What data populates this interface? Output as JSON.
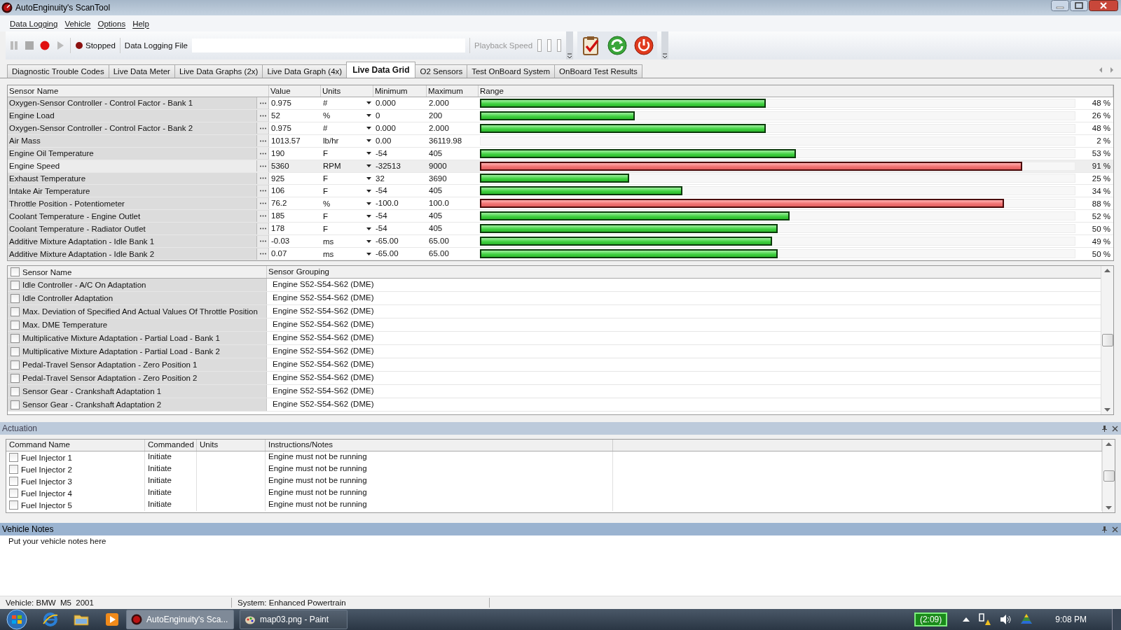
{
  "window": {
    "title": "AutoEnginuity's ScanTool"
  },
  "menu": [
    "Data Logging",
    "Vehicle",
    "Options",
    "Help"
  ],
  "toolbar": {
    "status": "Stopped",
    "logging_file_label": "Data Logging File",
    "playback_label": "Playback Speed"
  },
  "tabs": [
    {
      "label": "Diagnostic Trouble Codes",
      "selected": false
    },
    {
      "label": "Live Data Meter",
      "selected": false
    },
    {
      "label": "Live Data Graphs (2x)",
      "selected": false
    },
    {
      "label": "Live Data Graph (4x)",
      "selected": false
    },
    {
      "label": "Live Data Grid",
      "selected": true
    },
    {
      "label": "O2 Sensors",
      "selected": false
    },
    {
      "label": "Test OnBoard System",
      "selected": false
    },
    {
      "label": "OnBoard Test Results",
      "selected": false
    }
  ],
  "live_grid": {
    "columns": [
      "Sensor Name",
      "Value",
      "Units",
      "Minimum",
      "Maximum",
      "Range"
    ],
    "rows": [
      {
        "name": "Oxygen-Sensor Controller - Control Factor - Bank 1",
        "value": "0.975",
        "unit": "#",
        "minimum": "0.000",
        "maximum": "2.000",
        "level": 0.48,
        "reading": "48 %",
        "alarm": false,
        "selected": false
      },
      {
        "name": "Engine Load",
        "value": "52",
        "unit": "%",
        "minimum": "0",
        "maximum": "200",
        "level": 0.26,
        "reading": "26 %",
        "alarm": false,
        "selected": false
      },
      {
        "name": "Oxygen-Sensor Controller - Control Factor - Bank 2",
        "value": "0.975",
        "unit": "#",
        "minimum": "0.000",
        "maximum": "2.000",
        "level": 0.48,
        "reading": "48 %",
        "alarm": false,
        "selected": false
      },
      {
        "name": "Air Mass",
        "value": "1013.57",
        "unit": "lb/hr",
        "minimum": "0.00",
        "maximum": "36119.98",
        "reading": "2 %",
        "selected": false
      },
      {
        "name": "Engine Oil Temperature",
        "value": "190",
        "unit": "F",
        "minimum": "-54",
        "maximum": "405",
        "level": 0.53,
        "reading": "53 %",
        "alarm": false,
        "selected": false
      },
      {
        "name": "Engine Speed",
        "value": "5360",
        "unit": "RPM",
        "minimum": "-32513",
        "maximum": "9000",
        "level": 0.91,
        "reading": "91 %",
        "alarm": true,
        "selected": true
      },
      {
        "name": "Exhaust Temperature",
        "value": "925",
        "unit": "F",
        "minimum": "32",
        "maximum": "3690",
        "level": 0.25,
        "reading": "25 %",
        "alarm": false,
        "selected": false
      },
      {
        "name": "Intake Air Temperature",
        "value": "106",
        "unit": "F",
        "minimum": "-54",
        "maximum": "405",
        "level": 0.34,
        "reading": "34 %",
        "alarm": false,
        "selected": false
      },
      {
        "name": "Throttle Position - Potentiometer",
        "value": "76.2",
        "unit": "%",
        "minimum": "-100.0",
        "maximum": "100.0",
        "level": 0.88,
        "reading": "88 %",
        "alarm": true,
        "selected": false
      },
      {
        "name": "Coolant Temperature - Engine Outlet",
        "value": "185",
        "unit": "F",
        "minimum": "-54",
        "maximum": "405",
        "level": 0.52,
        "reading": "52 %",
        "alarm": false,
        "selected": false
      },
      {
        "name": "Coolant Temperature - Radiator Outlet",
        "value": "178",
        "unit": "F",
        "minimum": "-54",
        "maximum": "405",
        "level": 0.5,
        "reading": "50 %",
        "alarm": false,
        "selected": false
      },
      {
        "name": "Additive Mixture Adaptation - Idle Bank 1",
        "value": "-0.03",
        "unit": "ms",
        "minimum": "-65.00",
        "maximum": "65.00",
        "level": 0.49,
        "reading": "49 %",
        "alarm": false,
        "selected": false
      },
      {
        "name": "Additive Mixture Adaptation - Idle Bank 2",
        "value": "0.07",
        "unit": "ms",
        "minimum": "-65.00",
        "maximum": "65.00",
        "level": 0.5,
        "reading": "50 %",
        "alarm": false,
        "selected": false
      }
    ]
  },
  "sensor_list": {
    "columns": [
      "Sensor Name",
      "Sensor Grouping"
    ],
    "all_checked": false,
    "rows": [
      {
        "name": "Idle Controller - A/C On Adaptation",
        "group": "Engine S52-S54-S62 (DME)",
        "checked": false
      },
      {
        "name": "Idle Controller Adaptation",
        "group": "Engine S52-S54-S62 (DME)",
        "checked": false
      },
      {
        "name": "Max. Deviation of Specified And Actual Values Of Throttle Position",
        "group": "Engine S52-S54-S62 (DME)",
        "checked": false
      },
      {
        "name": "Max. DME Temperature",
        "group": "Engine S52-S54-S62 (DME)",
        "checked": false
      },
      {
        "name": "Multiplicative Mixture Adaptation - Partial Load - Bank 1",
        "group": "Engine S52-S54-S62 (DME)",
        "checked": false
      },
      {
        "name": "Multiplicative Mixture Adaptation - Partial Load - Bank 2",
        "group": "Engine S52-S54-S62 (DME)",
        "checked": false
      },
      {
        "name": "Pedal-Travel Sensor Adaptation - Zero Position 1",
        "group": "Engine S52-S54-S62 (DME)",
        "checked": false
      },
      {
        "name": "Pedal-Travel Sensor Adaptation - Zero Position 2",
        "group": "Engine S52-S54-S62 (DME)",
        "checked": false
      },
      {
        "name": "Sensor Gear - Crankshaft  Adaptation  1",
        "group": "Engine S52-S54-S62 (DME)",
        "checked": false
      },
      {
        "name": "Sensor Gear - Crankshaft  Adaptation  2",
        "group": "Engine S52-S54-S62 (DME)",
        "checked": false
      }
    ]
  },
  "actuation": {
    "title": "Actuation",
    "columns": [
      "Command Name",
      "Commanded",
      "Units",
      "Instructions/Notes"
    ],
    "rows": [
      {
        "name": "Fuel Injector 1",
        "commanded": "Initiate",
        "notes": "Engine must not be running",
        "checked": false
      },
      {
        "name": "Fuel Injector 2",
        "commanded": "Initiate",
        "notes": "Engine must not be running",
        "checked": false
      },
      {
        "name": "Fuel Injector 3",
        "commanded": "Initiate",
        "notes": "Engine must not be running",
        "checked": false
      },
      {
        "name": "Fuel Injector 4",
        "commanded": "Initiate",
        "notes": "Engine must not be running",
        "checked": false
      },
      {
        "name": "Fuel Injector 5",
        "commanded": "Initiate",
        "notes": "Engine must not be running",
        "checked": false
      }
    ]
  },
  "vehicle_notes": {
    "title": "Vehicle Notes",
    "text": "Put your vehicle notes here"
  },
  "status_bar": [
    "Vehicle: BMW  M5  2001",
    "System: Enhanced Powertrain"
  ],
  "taskbar": {
    "tasks": [
      {
        "label": "AutoEnginuity's Sca...",
        "selected": true
      },
      {
        "label": "map03.png - Paint",
        "selected": false
      }
    ],
    "battery": "(2:09)",
    "clock": "9:08 PM"
  }
}
